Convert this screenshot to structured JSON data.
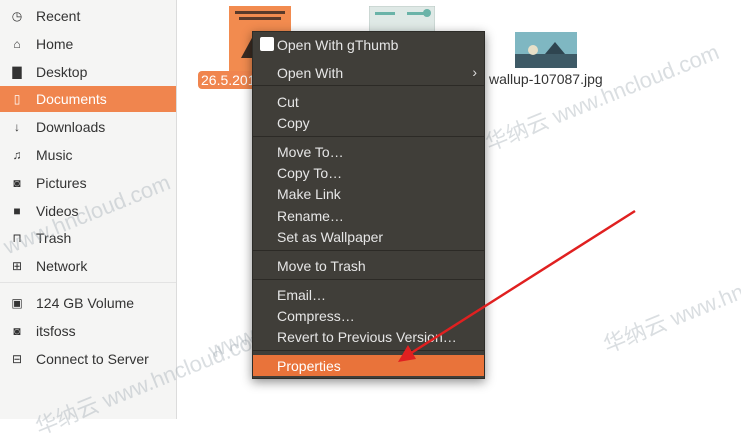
{
  "sidebar": {
    "items": [
      {
        "label": "Recent",
        "icon": "clock-icon",
        "glyph": "◷"
      },
      {
        "label": "Home",
        "icon": "home-icon",
        "glyph": "⌂"
      },
      {
        "label": "Desktop",
        "icon": "folder-icon",
        "glyph": "▇"
      },
      {
        "label": "Documents",
        "icon": "document-icon",
        "glyph": "▯"
      },
      {
        "label": "Downloads",
        "icon": "download-icon",
        "glyph": "↓"
      },
      {
        "label": "Music",
        "icon": "music-icon",
        "glyph": "♫"
      },
      {
        "label": "Pictures",
        "icon": "camera-icon",
        "glyph": "◙"
      },
      {
        "label": "Videos",
        "icon": "video-icon",
        "glyph": "■"
      },
      {
        "label": "Trash",
        "icon": "trash-icon",
        "glyph": "⊓"
      },
      {
        "label": "Network",
        "icon": "network-icon",
        "glyph": "⊞"
      },
      {
        "label": "124 GB Volume",
        "icon": "drive-icon",
        "glyph": "▣"
      },
      {
        "label": "itsfoss",
        "icon": "drive-icon",
        "glyph": "◙"
      },
      {
        "label": "Connect to Server",
        "icon": "server-icon",
        "glyph": "⊟"
      }
    ]
  },
  "files": {
    "selected_label": "26.5.201",
    "wallpaper_label": "wallup-107087.jpg"
  },
  "menu": {
    "items": [
      "Open With gThumb",
      "Open With",
      "Cut",
      "Copy",
      "Move To…",
      "Copy To…",
      "Make Link",
      "Rename…",
      "Set as Wallpaper",
      "Move to Trash",
      "Email…",
      "Compress…",
      "Revert to Previous Version…",
      "Properties"
    ]
  },
  "watermark": {
    "text_cn": "华纳云 www.hncloud.com",
    "text_en": "www.hncloud.com"
  },
  "colors": {
    "accent": "#f0854e",
    "menu_bg": "#403e39",
    "arrow": "#e02020"
  }
}
